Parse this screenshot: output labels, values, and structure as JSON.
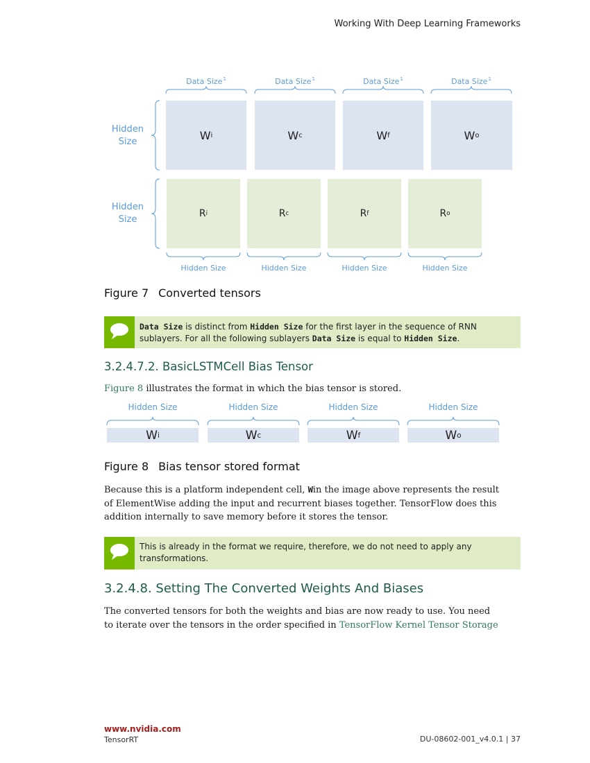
{
  "header": {
    "title": "Working With Deep Learning Frameworks"
  },
  "figure7": {
    "top_labels": [
      "Data Size",
      "Data Size",
      "Data Size",
      "Data Size"
    ],
    "top_labels_sup": "1",
    "side_label_1": "Hidden Size",
    "side_label_2": "Hidden Size",
    "w_boxes": [
      {
        "base": "W",
        "sub": "i"
      },
      {
        "base": "W",
        "sub": "c"
      },
      {
        "base": "W",
        "sub": "f"
      },
      {
        "base": "W",
        "sub": "o"
      }
    ],
    "r_boxes": [
      {
        "base": "R",
        "sub": "i"
      },
      {
        "base": "R",
        "sub": "c"
      },
      {
        "base": "R",
        "sub": "f"
      },
      {
        "base": "R",
        "sub": "o"
      }
    ],
    "bottom_labels": [
      "Hidden Size",
      "Hidden Size",
      "Hidden Size",
      "Hidden Size"
    ],
    "caption_num": "Figure 7",
    "caption_text": "Converted tensors"
  },
  "note1": {
    "code1": "Data Size",
    "t1": " is distinct from ",
    "code2": "Hidden Size",
    "t2": " for the first layer in the sequence of RNN",
    "t3": "sublayers. For all the following sublayers ",
    "code3": "Data Size",
    "t4": " is equal to ",
    "code4": "Hidden Size",
    "t5": "."
  },
  "section1": {
    "heading": "3.2.4.7.2. BasicLSTMCell Bias Tensor",
    "link": "Figure 8",
    "text": " illustrates the format in which the bias tensor is stored."
  },
  "figure8": {
    "labels": [
      "Hidden Size",
      "Hidden Size",
      "Hidden Size",
      "Hidden Size"
    ],
    "boxes": [
      {
        "base": "W",
        "sub": "i"
      },
      {
        "base": "W",
        "sub": "c"
      },
      {
        "base": "W",
        "sub": "f"
      },
      {
        "base": "W",
        "sub": "o"
      }
    ],
    "caption_num": "Figure 8",
    "caption_text": "Bias tensor stored format"
  },
  "paragraph1": {
    "t1": "Because this is a platform independent cell, ",
    "code": "W",
    "t2": "in the image above represents the result",
    "line2": "of ElementWise adding the input and recurrent biases together. TensorFlow does this",
    "line3": "addition internally to save memory before it stores the tensor."
  },
  "note2": {
    "line1": "This is already in the format we require, therefore, we do not need to apply any",
    "line2": "transformations."
  },
  "section2": {
    "heading": "3.2.4.8. Setting The Converted Weights And Biases",
    "line1": "The converted tensors for both the weights and bias are now ready to use. You need",
    "line2_text": "to iterate over the tensors in the order specified in ",
    "line2_link": "TensorFlow Kernel Tensor Storage"
  },
  "footer": {
    "link": "www.nvidia.com",
    "product": "TensorRT",
    "doc": "DU-08602-001_v4.0.1 | 37"
  }
}
